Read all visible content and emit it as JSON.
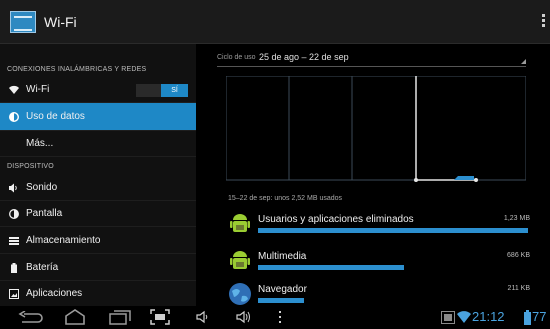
{
  "action_bar": {
    "title": "Wi-Fi"
  },
  "sections": {
    "wireless": "CONEXIONES INALÁMBRICAS Y REDES",
    "device": "DISPOSITIVO"
  },
  "menu": {
    "wifi": {
      "label": "Wi-Fi",
      "toggle": "SÍ"
    },
    "data_usage": {
      "label": "Uso de datos"
    },
    "more": {
      "label": "Más..."
    },
    "sound": {
      "label": "Sonido"
    },
    "display": {
      "label": "Pantalla"
    },
    "storage": {
      "label": "Almacenamiento"
    },
    "battery": {
      "label": "Batería"
    },
    "apps": {
      "label": "Aplicaciones"
    }
  },
  "usage": {
    "cycle_label": "Ciclo de uso",
    "cycle_value": "25 de ago – 22 de sep",
    "summary": "15–22 de sep: unos 2,52 MB usados",
    "apps": [
      {
        "name": "Usuarios y aplicaciones eliminados",
        "size": "1,23 MB",
        "fraction": 1.0,
        "icon": "android-icon"
      },
      {
        "name": "Multimedia",
        "size": "686 KB",
        "fraction": 0.54,
        "icon": "android-icon"
      },
      {
        "name": "Navegador",
        "size": "211 KB",
        "fraction": 0.17,
        "icon": "globe-icon"
      }
    ]
  },
  "status": {
    "time": "21:12",
    "battery": "77"
  },
  "colors": {
    "accent": "#1e88c6",
    "bar": "#2c8fcf",
    "status": "#4aa3df"
  }
}
